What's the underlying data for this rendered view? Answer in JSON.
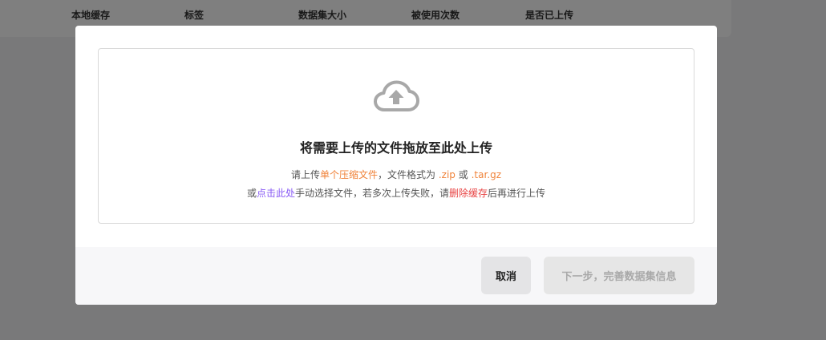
{
  "background_table": {
    "columns": [
      "本地缓存",
      "标签",
      "数据集大小",
      "被使用次数",
      "是否已上传"
    ]
  },
  "dropzone": {
    "icon": "cloud-upload-icon",
    "title": "将需要上传的文件拖放至此处上传",
    "line1": {
      "prefix": "请上传",
      "highlight": "单个压缩文件",
      "middle": "，文件格式为",
      "format1": ".zip",
      "or": "或",
      "format2": ".tar.gz"
    },
    "line2": {
      "prefix": "或",
      "click_link": "点击此处",
      "middle": "手动选择文件，若多次上传失败，请",
      "clear_link": "删除缓存",
      "suffix": "后再进行上传"
    }
  },
  "footer": {
    "cancel_label": "取消",
    "next_label": "下一步，完善数据集信息"
  },
  "colors": {
    "orange": "#f0833a",
    "purple": "#8a5cf5",
    "red": "#e84545"
  }
}
